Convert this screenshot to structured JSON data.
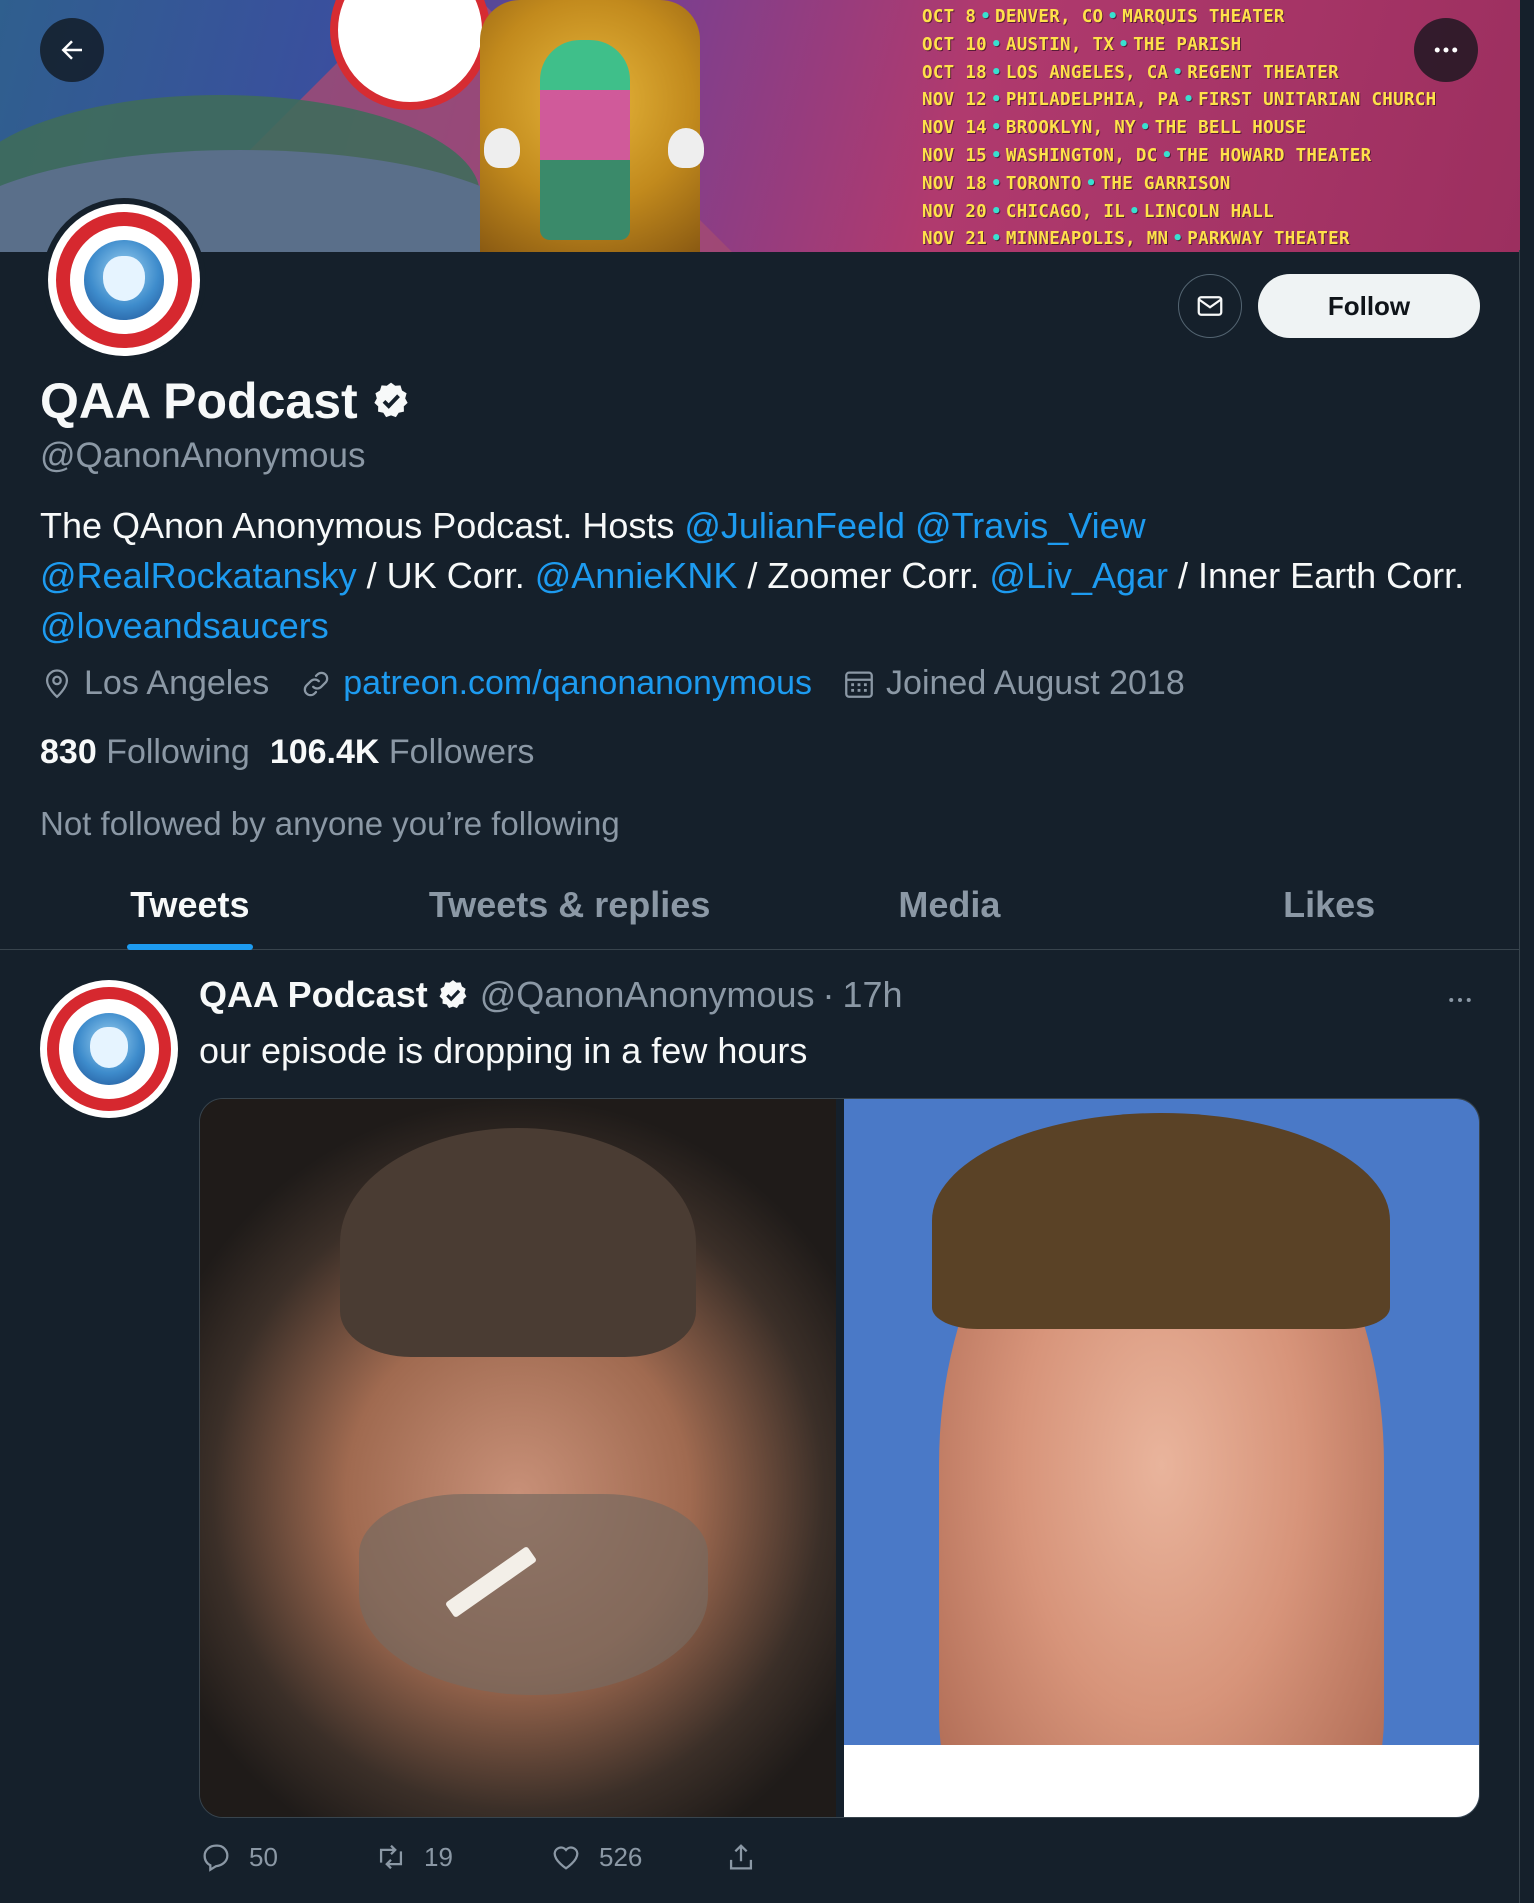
{
  "banner": {
    "tour_dates": [
      {
        "date": "OCT 8",
        "city": "DENVER, CO",
        "venue": "MARQUIS THEATER"
      },
      {
        "date": "OCT 10",
        "city": "AUSTIN, TX",
        "venue": "THE PARISH"
      },
      {
        "date": "OCT 18",
        "city": "LOS ANGELES, CA",
        "venue": "REGENT THEATER"
      },
      {
        "date": "NOV 12",
        "city": "PHILADELPHIA, PA",
        "venue": "FIRST UNITARIAN CHURCH"
      },
      {
        "date": "NOV 14",
        "city": "BROOKLYN, NY",
        "venue": "THE BELL HOUSE"
      },
      {
        "date": "NOV 15",
        "city": "WASHINGTON, DC",
        "venue": "THE HOWARD THEATER"
      },
      {
        "date": "NOV 18",
        "city": "TORONTO",
        "venue": "THE GARRISON"
      },
      {
        "date": "NOV 20",
        "city": "CHICAGO, IL",
        "venue": "LINCOLN HALL"
      },
      {
        "date": "NOV 21",
        "city": "MINNEAPOLIS, MN",
        "venue": "PARKWAY THEATER"
      }
    ],
    "separator": "•"
  },
  "nav": {
    "back_icon": "arrow-left-icon",
    "more_icon": "more-horizontal-icon"
  },
  "profile": {
    "name": "QAA Podcast",
    "handle": "@QanonAnonymous",
    "verified": true,
    "bio": {
      "part1": "The QAnon Anonymous Podcast. Hosts ",
      "m1": "@JulianFeeld",
      "sp1": " ",
      "m2": "@Travis_View",
      "sp2": " ",
      "m3": "@RealRockatansky",
      "part2": " / UK Corr. ",
      "m4": "@AnnieKNK",
      "part3": " / Zoomer Corr. ",
      "m5": "@Liv_Agar",
      "part4": " / Inner Earth Corr. ",
      "m6": "@loveandsaucers"
    },
    "location": "Los Angeles",
    "website": "patreon.com/qanonanonymous",
    "joined": "Joined August 2018",
    "following_count": "830",
    "following_label": "Following",
    "followers_count": "106.4K",
    "followers_label": "Followers",
    "not_followed": "Not followed by anyone you’re following",
    "follow_label": "Follow"
  },
  "tabs": [
    {
      "label": "Tweets",
      "active": true
    },
    {
      "label": "Tweets & replies",
      "active": false
    },
    {
      "label": "Media",
      "active": false
    },
    {
      "label": "Likes",
      "active": false
    }
  ],
  "tweet": {
    "name": "QAA Podcast",
    "handle": "@QanonAnonymous",
    "separator": "·",
    "time": "17h",
    "text": "our episode is dropping in a few hours",
    "reply_count": "50",
    "retweet_count": "19",
    "like_count": "526"
  },
  "colors": {
    "background": "#15202b",
    "accent": "#1d9bf0",
    "secondary_text": "#8b98a5",
    "tour_text": "#ffe14a"
  }
}
